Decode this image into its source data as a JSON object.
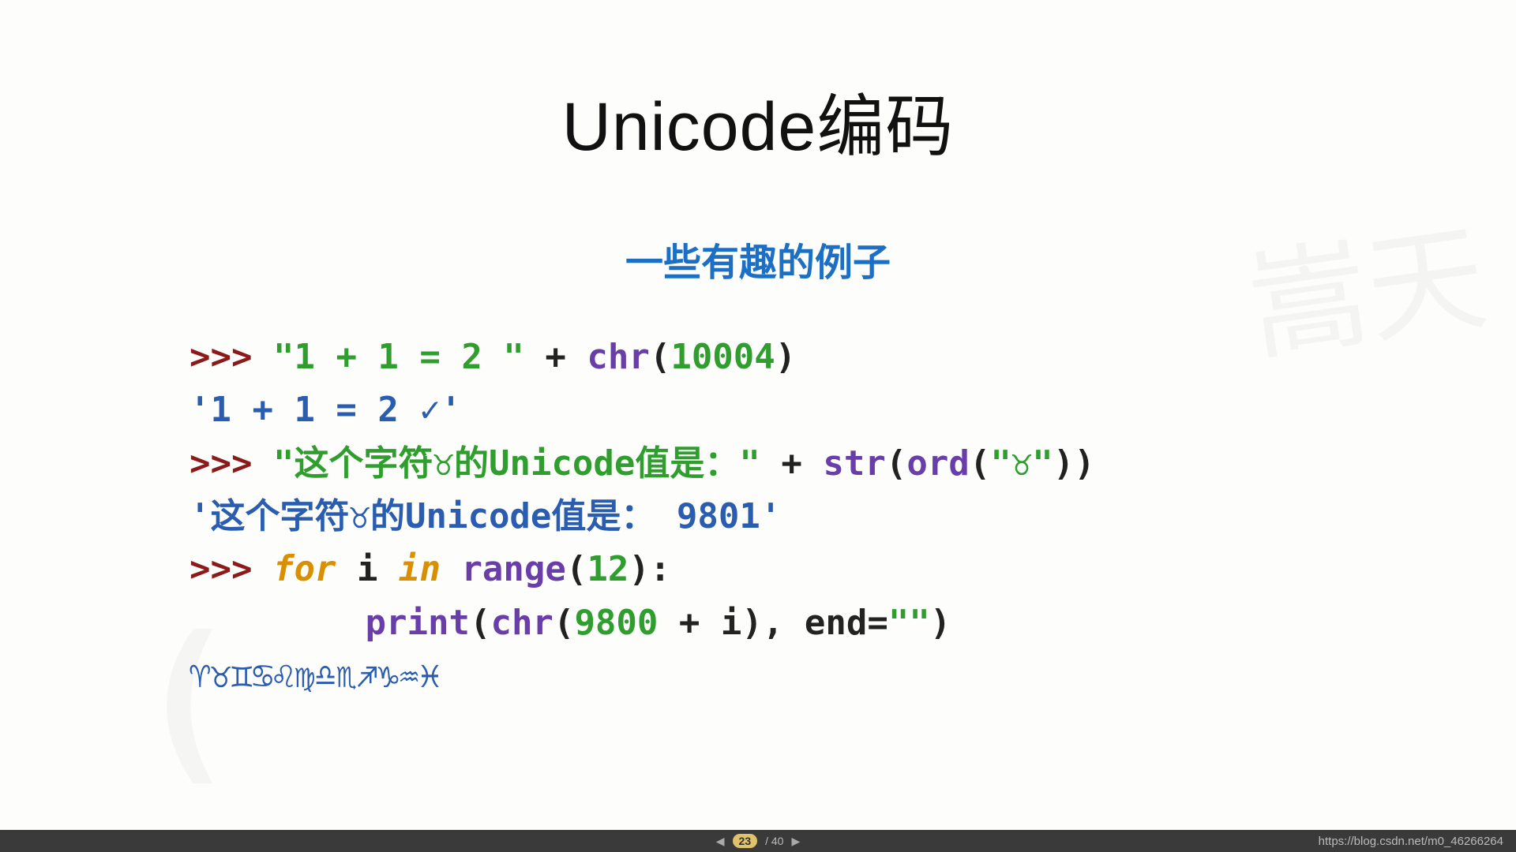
{
  "slide": {
    "title": "Unicode编码",
    "subtitle": "一些有趣的例子",
    "watermark1": "嵩天",
    "watermark2": "("
  },
  "code": {
    "l1": {
      "prompt": ">>> ",
      "str": "\"1 + 1 = 2 \"",
      "plus": " + ",
      "func": "chr",
      "open": "(",
      "arg": "10004",
      "close": ")"
    },
    "l2": "'1 + 1 = 2 ✓'",
    "l3": {
      "prompt": ">>> ",
      "str1": "\"这个字符♉的Unicode值是：\"",
      "plus": " + ",
      "func1": "str",
      "open1": "(",
      "func2": "ord",
      "open2": "(",
      "str2": "\"♉\"",
      "close": "))"
    },
    "l4": "'这个字符♉的Unicode值是： 9801'",
    "l5": {
      "prompt": ">>> ",
      "kw1": "for",
      "sp1": " ",
      "id1": "i",
      "sp2": " ",
      "kw2": "in",
      "sp3": " ",
      "func": "range",
      "open": "(",
      "arg": "12",
      "close": "):"
    },
    "l6": {
      "func1": "print",
      "open1": "(",
      "func2": "chr",
      "open2": "(",
      "arg1": "9800",
      "plus": " + ",
      "id": "i",
      "close2": ")",
      "comma": ", ",
      "kwend": "end",
      "eq": "=",
      "str": "\"\"",
      "close1": ")"
    },
    "l7": "♈♉♊♋♌♍♎♏♐♑♒♓"
  },
  "footer": {
    "current": "23",
    "total": "/ 40",
    "url": "https://blog.csdn.net/m0_46266264"
  }
}
